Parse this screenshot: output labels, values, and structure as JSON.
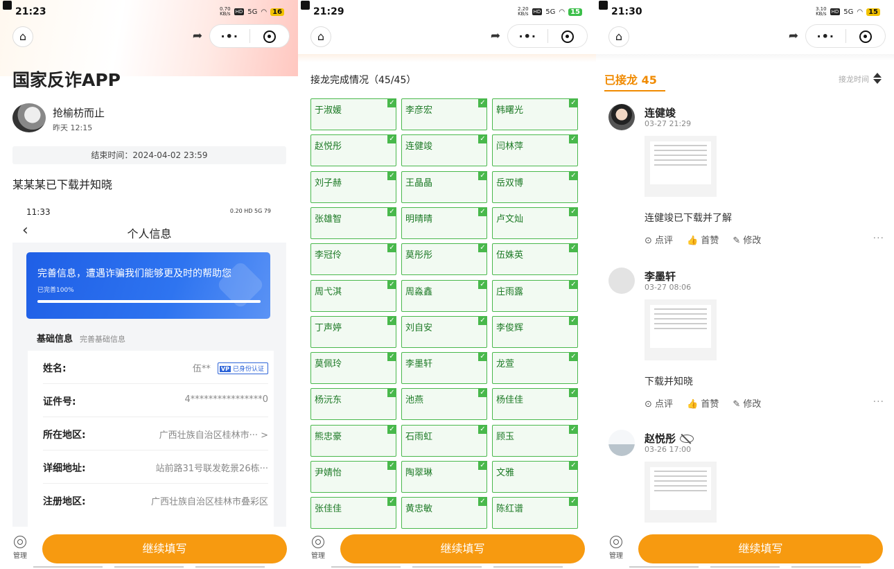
{
  "panel1": {
    "status": {
      "time": "21:23",
      "speed": "0.70",
      "speed_unit": "KB/s",
      "hd": "HD",
      "net": "5G",
      "battery": "16"
    },
    "title": "国家反诈APP",
    "author": "抢榆枋而止",
    "posted": "昨天 12:15",
    "end_time": "结束时间：2024-04-02 23:59",
    "message": "某某某已下载并知晓",
    "screenshot": {
      "time": "11:33",
      "status_right": "0.20 HD 5G 79",
      "title": "个人信息",
      "banner_text": "完善信息，遭遇诈骗我们能够更及时的帮助您",
      "progress_text": "已完善100%",
      "progress_fraction": 1.0,
      "section": "基础信息",
      "section_hint": "完善基础信息",
      "verified": "已身份认证",
      "verified_logo": "VP",
      "rows": [
        {
          "key": "姓名:",
          "value": "伍**"
        },
        {
          "key": "证件号:",
          "value": "4****************0"
        },
        {
          "key": "所在地区:",
          "value": "广西壮族自治区桂林市··· >"
        },
        {
          "key": "详细地址:",
          "value": "站前路31号联发乾景26栋···"
        },
        {
          "key": "注册地区:",
          "value": "广西壮族自治区桂林市叠彩区"
        }
      ]
    },
    "manage": "管理",
    "cta": "继续填写"
  },
  "panel2": {
    "status": {
      "time": "21:29",
      "speed": "2.20",
      "speed_unit": "KB/s",
      "hd": "HD",
      "net": "5G",
      "battery": "15"
    },
    "heading": "接龙完成情况（45/45）",
    "names": [
      "于淑媛",
      "李彦宏",
      "韩曙光",
      "赵悦彤",
      "连健竣",
      "闫林萍",
      "刘子赫",
      "王晶晶",
      "岳双博",
      "张雄智",
      "明晴晴",
      "卢文灿",
      "李冠伶",
      "莫彤彤",
      "伍姝英",
      "周弋淇",
      "周淼鑫",
      "庄雨露",
      "丁声婷",
      "刘自安",
      "李俊辉",
      "莫佩玲",
      "李墨轩",
      "龙萱",
      "杨沅东",
      "池燕",
      "杨佳佳",
      "熊忠豪",
      "石雨虹",
      "顾玉",
      "尹婧怡",
      "陶翠琳",
      "文雅",
      "张佳佳",
      "黄忠敏",
      "陈红谱"
    ],
    "check": "✓",
    "manage": "管理",
    "cta": "继续填写"
  },
  "panel3": {
    "status": {
      "time": "21:30",
      "speed": "3.10",
      "speed_unit": "KB/s",
      "hd": "HD",
      "net": "5G",
      "battery": "15"
    },
    "tab": "已接龙 45",
    "sort": "接龙时间",
    "entries": [
      {
        "name": "连健竣",
        "time": "03-27 21:29",
        "text": "连健竣已下载并了解",
        "comment": "点评",
        "like": "首赞",
        "edit": "修改",
        "more": "···"
      },
      {
        "name": "李墨轩",
        "time": "03-27 08:06",
        "text": "下载并知晓",
        "comment": "点评",
        "like": "首赞",
        "edit": "修改",
        "more": "···"
      },
      {
        "name": "赵悦彤",
        "time": "03-26 17:00"
      }
    ],
    "manage": "管理",
    "cta": "继续填写"
  },
  "colors": {
    "accent": "#f79a10",
    "green": "#49b84c",
    "blue": "#2e74f0"
  },
  "icons": [
    "home-icon",
    "share-icon",
    "more-dots-icon",
    "record-icon",
    "manage-icon",
    "check-icon",
    "comment-icon",
    "like-icon",
    "edit-icon",
    "hidden-eye-icon",
    "sort-icon"
  ]
}
